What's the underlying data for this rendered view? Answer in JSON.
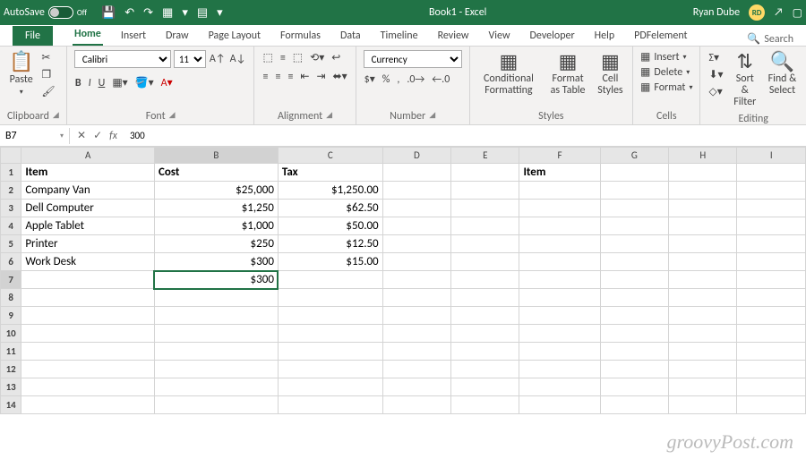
{
  "titlebar": {
    "autosave": "AutoSave",
    "toggle_state": "Off",
    "title": "Book1 - Excel",
    "user": "Ryan Dube",
    "initials": "RD"
  },
  "tabs": [
    "File",
    "Home",
    "Insert",
    "Draw",
    "Page Layout",
    "Formulas",
    "Data",
    "Timeline",
    "Review",
    "View",
    "Developer",
    "Help",
    "PDFelement"
  ],
  "active_tab": "Home",
  "search": "Search",
  "ribbon": {
    "clipboard": {
      "paste": "Paste",
      "label": "Clipboard"
    },
    "font": {
      "name": "Calibri",
      "size": "11",
      "label": "Font"
    },
    "alignment": {
      "label": "Alignment"
    },
    "number": {
      "format": "Currency",
      "label": "Number"
    },
    "styles": {
      "cf": "Conditional Formatting",
      "fat": "Format as Table",
      "cs": "Cell Styles",
      "label": "Styles"
    },
    "cells": {
      "insert": "Insert",
      "delete": "Delete",
      "format": "Format",
      "label": "Cells"
    },
    "editing": {
      "sort": "Sort & Filter",
      "find": "Find & Select",
      "label": "Editing"
    }
  },
  "namebox": "B7",
  "formula": "300",
  "columns": [
    "A",
    "B",
    "C",
    "D",
    "E",
    "F",
    "G",
    "H",
    "I"
  ],
  "headers": {
    "A": "Item",
    "B": "Cost",
    "C": "Tax",
    "F": "Item"
  },
  "rows": [
    {
      "n": 2,
      "A": "Company Van",
      "B": "$25,000",
      "C": "$1,250.00"
    },
    {
      "n": 3,
      "A": "Dell Computer",
      "B": "$1,250",
      "C": "$62.50"
    },
    {
      "n": 4,
      "A": "Apple Tablet",
      "B": "$1,000",
      "C": "$50.00"
    },
    {
      "n": 5,
      "A": "Printer",
      "B": "$250",
      "C": "$12.50"
    },
    {
      "n": 6,
      "A": "Work Desk",
      "B": "$300",
      "C": "$15.00"
    },
    {
      "n": 7,
      "B": "$300"
    }
  ],
  "active_cell": "B7",
  "watermark": "groovyPost.com"
}
